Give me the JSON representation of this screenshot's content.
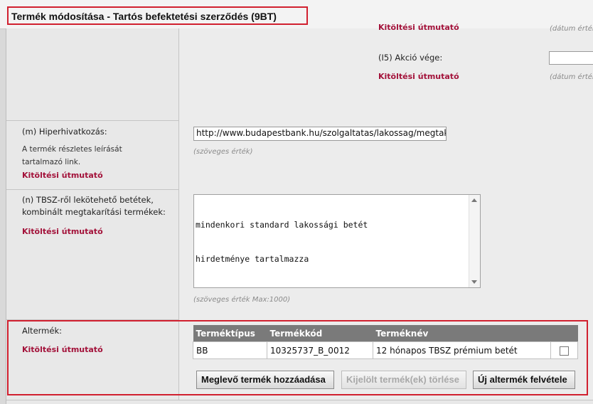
{
  "window": {
    "title": "Termék módosítása - Tartós befektetési szerződés (9BT)"
  },
  "guide_label": "Kitöltési útmutató",
  "top_section": {
    "date_hint_1": "(dátum érték",
    "action_end_label": "(I5) Akció vége:",
    "action_end_value": "",
    "date_hint_2": "(dátum érték"
  },
  "hyperlink_section": {
    "label": "(m) Hiperhivatkozás:",
    "description_line1": "A termék részletes leírását",
    "description_line2": "tartalmazó link.",
    "value": "http://www.budapestbank.hu/szolgaltatas/lakossag/megtakar",
    "hint": "(szöveges érték)"
  },
  "deposits_section": {
    "label_line1": "(n) TBSZ-ről lekötehető betétek,",
    "label_line2": "kombinált megtakarítási termékek:",
    "text_line1": "mindenkori standard lakossági betét",
    "text_line2": "hirdetménye tartalmazza",
    "hint": "(szöveges érték Max:1000)"
  },
  "subproduct_section": {
    "label": "Altermék:",
    "columns": [
      "Terméktípus",
      "Termékkód",
      "Terméknév"
    ],
    "rows": [
      {
        "type": "BB",
        "code": "10325737_B_0012",
        "name": "12 hónapos TBSZ prémium betét",
        "checked": false
      }
    ],
    "buttons": {
      "add_existing": "Meglevő termék hozzáadása",
      "delete_selected": "Kijelölt termék(ek) törlése",
      "new_subproduct": "Új altermék felvétele"
    }
  }
}
